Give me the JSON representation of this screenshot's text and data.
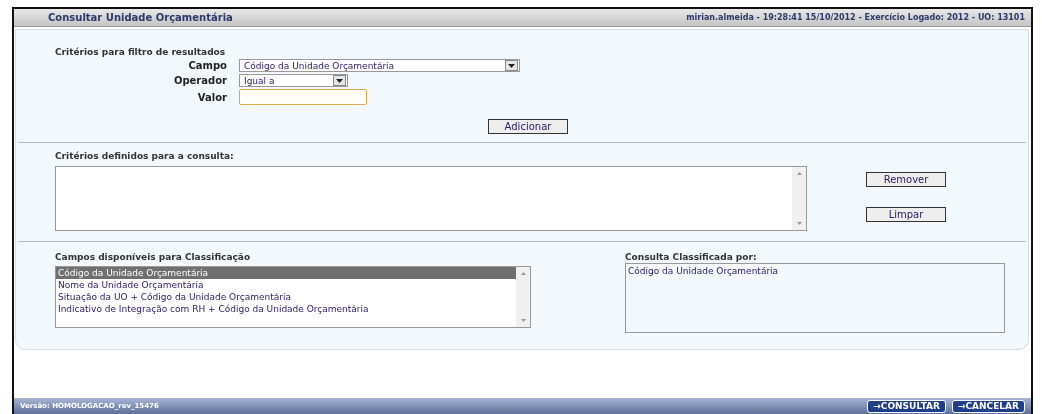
{
  "window": {
    "title": "Consultar Unidade Orçamentária",
    "session_info": "mirian.almeida - 19:28:41 15/10/2012 - Exercício Logado: 2012 - UO: 13101"
  },
  "filter": {
    "heading": "Critérios para filtro de resultados",
    "fields": [
      {
        "kind": "select",
        "label": "Campo",
        "value": "Código da Unidade Orçamentária"
      },
      {
        "kind": "select",
        "label": "Operador",
        "value": "Igual a"
      },
      {
        "kind": "input",
        "label": "Valor"
      }
    ],
    "add_button": "Adicionar"
  },
  "criteria": {
    "heading": "Critérios definidos para a consulta:",
    "buttons": [
      "Remover",
      "Limpar"
    ]
  },
  "sort": {
    "available_heading": "Campos disponíveis para Classificação",
    "available": [
      {
        "label": "Código da Unidade Orçamentária",
        "selected": true
      },
      {
        "label": "Nome da Unidade Orçamentária",
        "selected": false
      },
      {
        "label": "Situação da UO + Código da Unidade Orçamentária",
        "selected": false
      },
      {
        "label": "Indicativo de Integração com RH + Código da Unidade Orçamentária",
        "selected": false
      }
    ],
    "chosen_heading": "Consulta Classificada por:",
    "chosen": [
      "Código da Unidade Orçamentária"
    ]
  },
  "status_bar": {
    "version": "Versão: HOMOLOGACAO_rev_15476",
    "buttons": [
      {
        "icon": "→",
        "label": "CONSULTAR"
      },
      {
        "icon": "→",
        "label": "CANCELAR"
      }
    ]
  }
}
